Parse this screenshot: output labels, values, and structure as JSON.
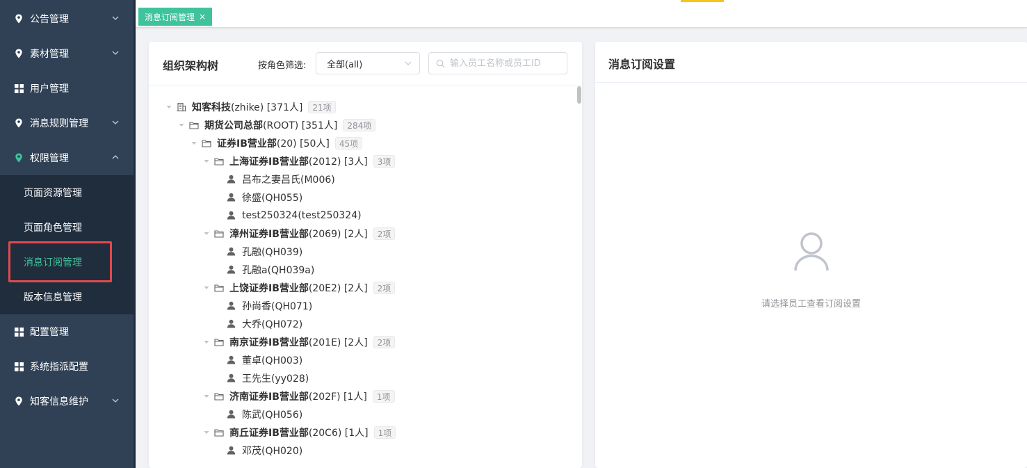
{
  "sidebar": {
    "menus": [
      {
        "label": "公告管理",
        "icon": "location-pin-icon",
        "expanded": false
      },
      {
        "label": "素材管理",
        "icon": "location-pin-icon",
        "expanded": false
      },
      {
        "label": "用户管理",
        "icon": "grid-icon"
      },
      {
        "label": "消息规则管理",
        "icon": "location-pin-icon",
        "expanded": false
      },
      {
        "label": "权限管理",
        "icon": "location-pin-icon",
        "expanded": true
      },
      {
        "label": "配置管理",
        "icon": "grid-icon"
      },
      {
        "label": "系统指派配置",
        "icon": "grid-icon"
      },
      {
        "label": "知客信息维护",
        "icon": "location-pin-icon",
        "expanded": false
      }
    ],
    "submenu": [
      {
        "label": "页面资源管理"
      },
      {
        "label": "页面角色管理"
      },
      {
        "label": "消息订阅管理",
        "active": true
      },
      {
        "label": "版本信息管理"
      }
    ],
    "active_color": "#3ec39c"
  },
  "tagsbar": {
    "tag_label": "消息订阅管理",
    "close": "×"
  },
  "org_panel": {
    "title": "组织架构树",
    "filter_label": "按角色筛选:",
    "role_select_value": "全部(all)",
    "search_placeholder": "输入员工名称或员工ID",
    "tree": [
      {
        "type": "root",
        "name": "知客科技",
        "suffix": "(zhike) [371人]",
        "badge": "21项"
      },
      {
        "type": "org",
        "name": "期货公司总部",
        "suffix": "(ROOT) [351人]",
        "badge": "284项"
      },
      {
        "type": "org",
        "name": "证券IB营业部",
        "suffix": "(20) [50人]",
        "badge": "45项"
      },
      {
        "type": "org",
        "name": "上海证券IB营业部",
        "suffix": "(2012) [3人]",
        "badge": "3项"
      },
      {
        "type": "person",
        "name": "吕布之妻吕氏(M006)"
      },
      {
        "type": "person",
        "name": "徐盛(QH055)"
      },
      {
        "type": "person",
        "name": "test250324(test250324)"
      },
      {
        "type": "org",
        "name": "漳州证券IB营业部",
        "suffix": "(2069) [2人]",
        "badge": "2项"
      },
      {
        "type": "person",
        "name": "孔融(QH039)"
      },
      {
        "type": "person",
        "name": "孔融a(QH039a)"
      },
      {
        "type": "org",
        "name": "上饶证券IB营业部",
        "suffix": "(20E2) [2人]",
        "badge": "2项"
      },
      {
        "type": "person",
        "name": "孙尚香(QH071)"
      },
      {
        "type": "person",
        "name": "大乔(QH072)"
      },
      {
        "type": "org",
        "name": "南京证券IB营业部",
        "suffix": "(201E) [2人]",
        "badge": "2项"
      },
      {
        "type": "person",
        "name": "董卓(QH003)"
      },
      {
        "type": "person",
        "name": "王先生(yy028)"
      },
      {
        "type": "org",
        "name": "济南证券IB营业部",
        "suffix": "(202F) [1人]",
        "badge": "1项"
      },
      {
        "type": "person",
        "name": "陈武(QH056)"
      },
      {
        "type": "org",
        "name": "商丘证券IB营业部",
        "suffix": "(20C6) [1人]",
        "badge": "1项"
      },
      {
        "type": "person",
        "name": "邓茂(QH020)"
      }
    ]
  },
  "subscription_panel": {
    "title": "消息订阅设置",
    "empty_icon": "user-icon",
    "empty_text": "请选择员工查看订阅设置"
  }
}
